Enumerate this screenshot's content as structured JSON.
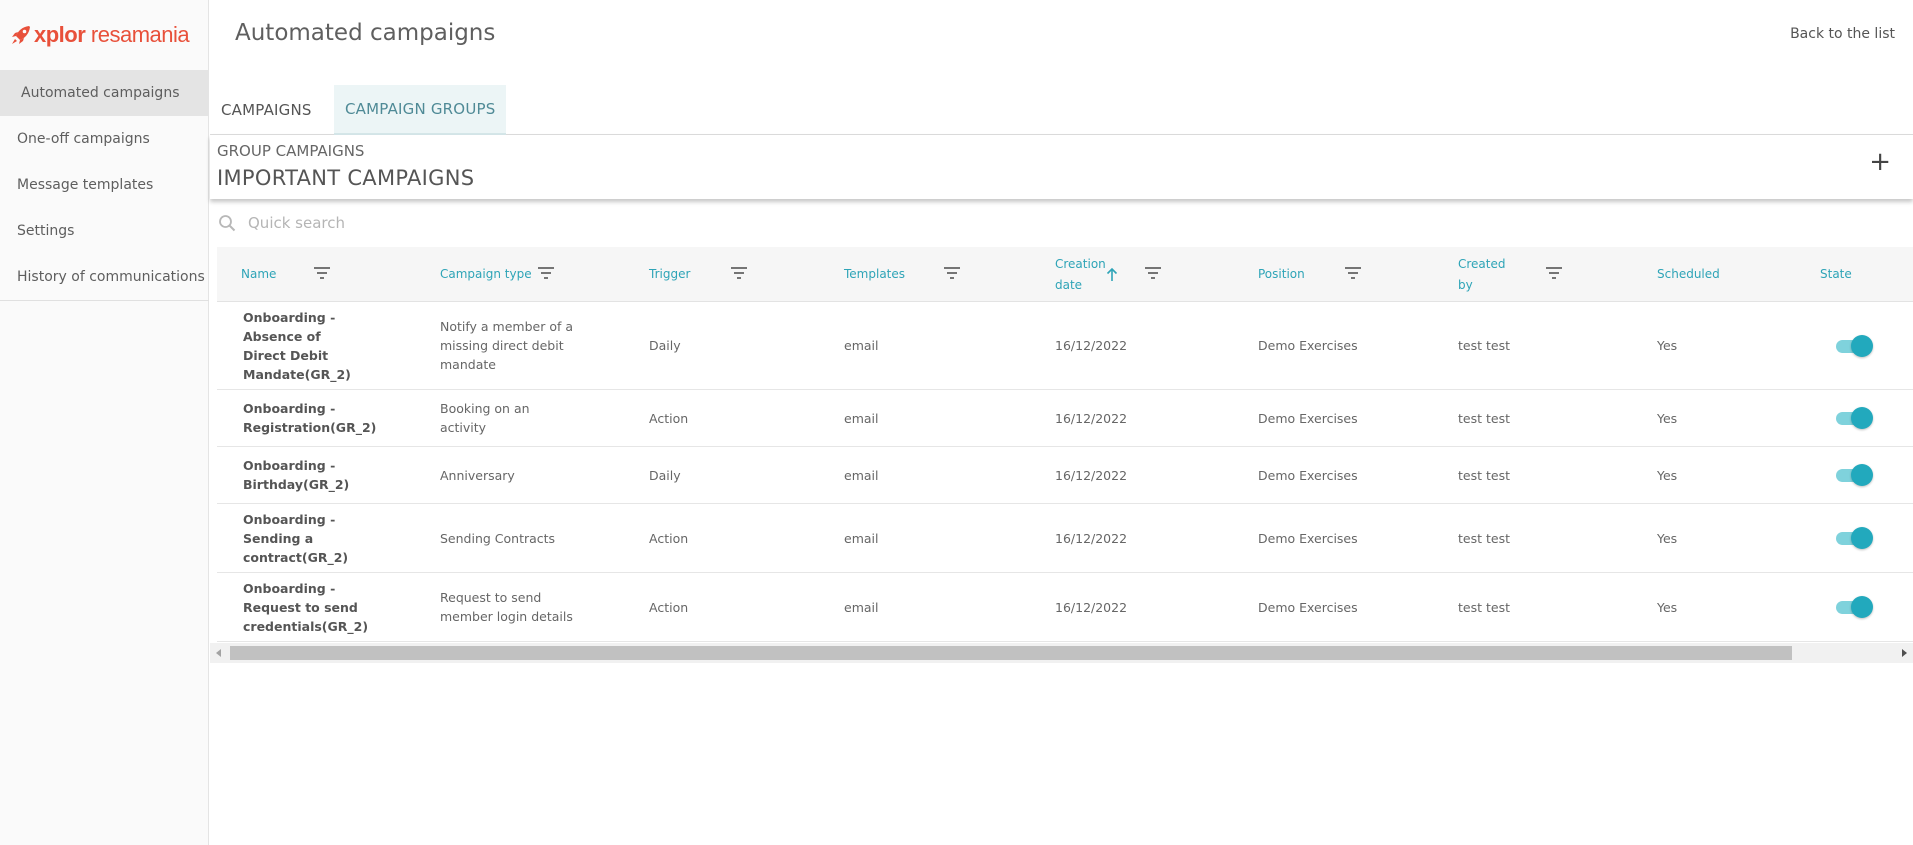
{
  "brand": {
    "logo_part1": "xplor",
    "logo_part2": "resamania",
    "color": "#e8503a"
  },
  "sidebar": {
    "items": [
      {
        "label": "Automated campaigns",
        "active": true
      },
      {
        "label": "One-off campaigns",
        "active": false
      },
      {
        "label": "Message templates",
        "active": false
      },
      {
        "label": "Settings",
        "active": false
      },
      {
        "label": "History of communications",
        "active": false
      }
    ]
  },
  "header": {
    "title": "Automated campaigns",
    "back_label": "Back to the list"
  },
  "tabs": [
    {
      "label": "CAMPAIGNS",
      "active": false
    },
    {
      "label": "CAMPAIGN GROUPS",
      "active": true
    }
  ],
  "group": {
    "label": "GROUP CAMPAIGNS",
    "name": "IMPORTANT CAMPAIGNS",
    "add_label": "+"
  },
  "search": {
    "placeholder": "Quick search",
    "value": ""
  },
  "table": {
    "accent_color": "#2ea4b7",
    "columns": [
      {
        "key": "name",
        "label": "Name",
        "filter": true,
        "sorted": false
      },
      {
        "key": "campaign_type",
        "label": "Campaign type",
        "filter": true,
        "sorted": false
      },
      {
        "key": "trigger",
        "label": "Trigger",
        "filter": true,
        "sorted": false
      },
      {
        "key": "templates",
        "label": "Templates",
        "filter": true,
        "sorted": false
      },
      {
        "key": "creation_date",
        "label": "Creation date",
        "filter": true,
        "sorted": "asc"
      },
      {
        "key": "position",
        "label": "Position",
        "filter": true,
        "sorted": false
      },
      {
        "key": "created_by",
        "label": "Created by",
        "filter": true,
        "sorted": false
      },
      {
        "key": "scheduled",
        "label": "Scheduled",
        "filter": false,
        "sorted": false
      },
      {
        "key": "state",
        "label": "State",
        "filter": false,
        "sorted": false
      }
    ],
    "rows": [
      {
        "name": "Onboarding - Absence of Direct Debit Mandate(GR_2)",
        "campaign_type": "Notify a member of a missing direct debit mandate",
        "trigger": "Daily",
        "templates": "email",
        "creation_date": "16/12/2022",
        "position": "Demo Exercises",
        "created_by": "test test",
        "scheduled": "Yes",
        "state": true
      },
      {
        "name": "Onboarding - Registration(GR_2)",
        "campaign_type": "Booking on an activity",
        "trigger": "Action",
        "templates": "email",
        "creation_date": "16/12/2022",
        "position": "Demo Exercises",
        "created_by": "test test",
        "scheduled": "Yes",
        "state": true
      },
      {
        "name": "Onboarding - Birthday(GR_2)",
        "campaign_type": "Anniversary",
        "trigger": "Daily",
        "templates": "email",
        "creation_date": "16/12/2022",
        "position": "Demo Exercises",
        "created_by": "test test",
        "scheduled": "Yes",
        "state": true
      },
      {
        "name": "Onboarding - Sending a contract(GR_2)",
        "campaign_type": "Sending Contracts",
        "trigger": "Action",
        "templates": "email",
        "creation_date": "16/12/2022",
        "position": "Demo Exercises",
        "created_by": "test test",
        "scheduled": "Yes",
        "state": true
      },
      {
        "name": "Onboarding - Request to send credentials(GR_2)",
        "campaign_type": "Request to send member login details",
        "trigger": "Action",
        "templates": "email",
        "creation_date": "16/12/2022",
        "position": "Demo Exercises",
        "created_by": "test test",
        "scheduled": "Yes",
        "state": true
      }
    ]
  }
}
